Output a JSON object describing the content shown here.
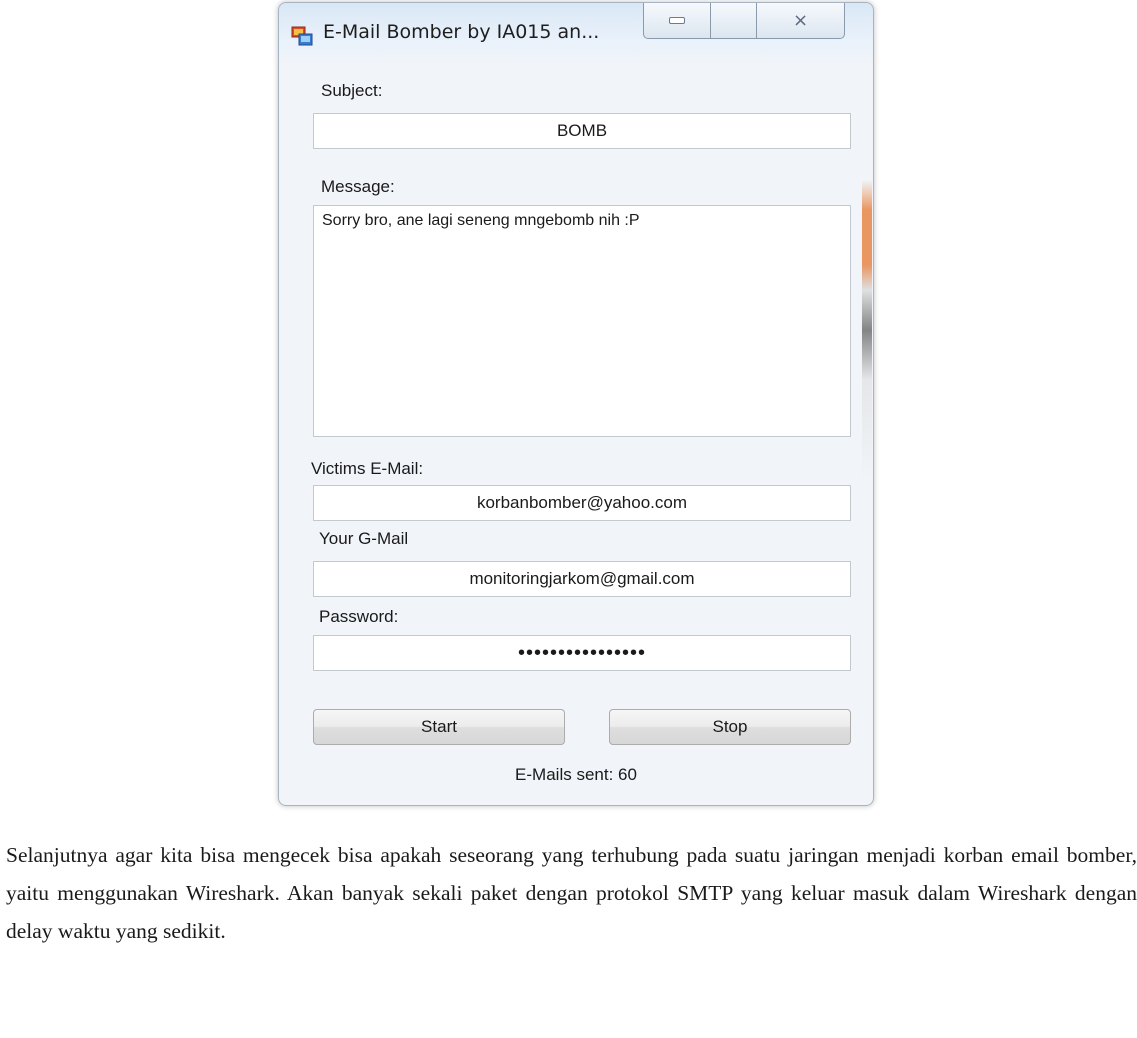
{
  "window": {
    "title": "E-Mail Bomber by IA015 an...",
    "icon": "app-window-icon",
    "controls": {
      "minimize": "minimize-icon",
      "close": "×"
    }
  },
  "form": {
    "subject_label": "Subject:",
    "subject_value": "BOMB",
    "message_label": "Message:",
    "message_value": "Sorry bro, ane lagi seneng mngebomb nih :P",
    "victim_label": "Victims E-Mail:",
    "victim_value": "korbanbomber@yahoo.com",
    "gmail_label": "Your G-Mail",
    "gmail_value": "monitoringjarkom@gmail.com",
    "password_label": "Password:",
    "password_value": "••••••••••••••••",
    "start_label": "Start",
    "stop_label": "Stop",
    "status_text": "E-Mails sent: 60"
  },
  "article": {
    "paragraph": "Selanjutnya agar kita bisa mengecek bisa apakah seseorang yang terhubung pada suatu jaringan menjadi korban email bomber, yaitu menggunakan Wireshark. Akan banyak sekali paket dengan protokol SMTP yang keluar masuk dalam Wireshark dengan delay waktu yang sedikit."
  },
  "colors": {
    "titlebar_top": "#d9e7f5",
    "window_body": "#f1f4f8",
    "field_border": "#c4c9d0",
    "edge_accent": "#e88c50"
  }
}
